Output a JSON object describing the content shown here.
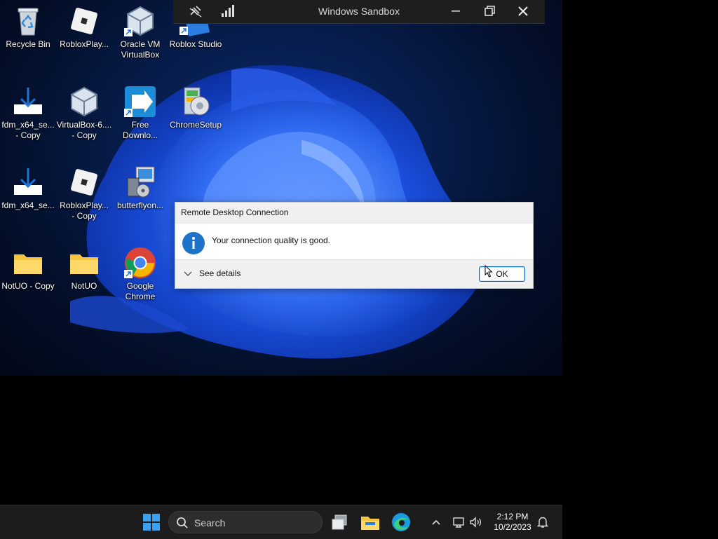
{
  "window": {
    "title": "Windows Sandbox"
  },
  "desktop_icons": [
    {
      "label": "Recycle Bin"
    },
    {
      "label": "RobloxPlay..."
    },
    {
      "label": "Oracle VM\nVirtualBox"
    },
    {
      "label": "Roblox Studio"
    },
    {
      "label": "fdm_x64_se...\n- Copy"
    },
    {
      "label": "VirtualBox-6....\n- Copy"
    },
    {
      "label": "Free\nDownlo..."
    },
    {
      "label": "ChromeSetup"
    },
    {
      "label": "fdm_x64_se..."
    },
    {
      "label": "RobloxPlay...\n- Copy"
    },
    {
      "label": "butterflyon..."
    },
    {
      "label": "NotUO - Copy"
    },
    {
      "label": "NotUO"
    },
    {
      "label": "Google\nChrome"
    }
  ],
  "dialog": {
    "title": "Remote Desktop Connection",
    "message": "Your connection quality is good.",
    "details_label": "See details",
    "ok_label": "OK"
  },
  "taskbar": {
    "search_placeholder": "Search",
    "time": "2:12 PM",
    "date": "10/2/2023"
  },
  "colors": {
    "accent": "#0067c0",
    "taskbar": "#1c1c1c",
    "titlebar": "#1e1e1e"
  }
}
